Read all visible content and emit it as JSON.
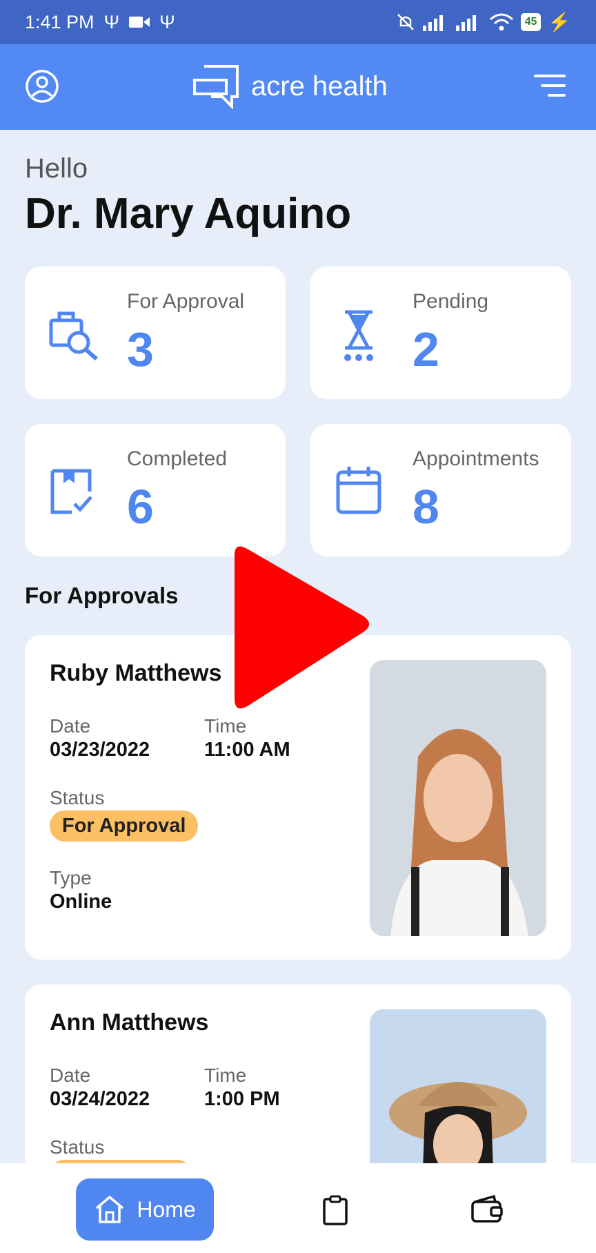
{
  "status_bar": {
    "time": "1:41 PM",
    "battery": "45"
  },
  "app_bar": {
    "brand": "acre health"
  },
  "greeting": {
    "hello": "Hello",
    "name": "Dr. Mary Aquino"
  },
  "stats": [
    {
      "label": "For Approval",
      "value": "3",
      "icon": "briefcase-search-icon"
    },
    {
      "label": "Pending",
      "value": "2",
      "icon": "hourglass-icon"
    },
    {
      "label": "Completed",
      "value": "6",
      "icon": "checked-clipboard-icon"
    },
    {
      "label": "Appointments",
      "value": "8",
      "icon": "calendar-icon"
    }
  ],
  "section_title": "For Approvals",
  "appointments": [
    {
      "name": "Ruby Matthews",
      "date_label": "Date",
      "date": "03/23/2022",
      "time_label": "Time",
      "time": "11:00 AM",
      "status_label": "Status",
      "status": "For Approval",
      "type_label": "Type",
      "type": "Online"
    },
    {
      "name": "Ann Matthews",
      "date_label": "Date",
      "date": "03/24/2022",
      "time_label": "Time",
      "time": "1:00 PM",
      "status_label": "Status"
    }
  ],
  "bottom_nav": {
    "home": "Home"
  },
  "colors": {
    "primary": "#5289f5",
    "status_bar": "#3f66c4",
    "badge": "#fbbf64",
    "background": "#e8eef9"
  }
}
